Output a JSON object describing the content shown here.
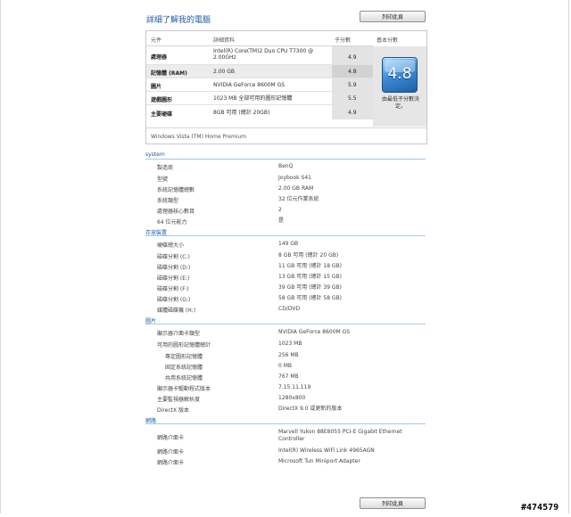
{
  "title": "詳細了解我的電腦",
  "print_label": "列印此頁",
  "score_table": {
    "headers": {
      "component": "元件",
      "details": "詳細資料",
      "subscore": "子分數",
      "base": "基本分數"
    },
    "rows": [
      {
        "component": "處理器",
        "detail_line1": "Intel(R) Core(TM)2 Duo CPU T7300 @",
        "detail_line2": "2.00GHz",
        "subscore": "4.9"
      },
      {
        "component": "記憶體 (RAM)",
        "detail_line1": "2.00 GB",
        "detail_line2": "",
        "subscore": "4.8"
      },
      {
        "component": "圖片",
        "detail_line1": "NVIDIA GeForce 8600M GS",
        "detail_line2": "",
        "subscore": "5.9"
      },
      {
        "component": "遊戲圖形",
        "detail_line1": "1023 MB 全部可用的圖形記憶體",
        "detail_line2": "",
        "subscore": "5.5"
      },
      {
        "component": "主要硬碟",
        "detail_line1": "8GB 可用 (總計 20GB)",
        "detail_line2": "",
        "subscore": "4.9"
      }
    ],
    "base_score": "4.8",
    "base_caption": "由最低子分數決定。",
    "edition": "Windows Vista (TM) Home Premium"
  },
  "sections": {
    "system": {
      "heading": "system",
      "rows": [
        {
          "label": "製造商",
          "value": "BenQ"
        },
        {
          "label": "型號",
          "value": "Joybook S41"
        },
        {
          "label": "系統記憶體總數",
          "value": "2.00 GB RAM"
        },
        {
          "label": "系統類型",
          "value": "32 位元作業系統"
        },
        {
          "label": "處理器核心數目",
          "value": "2"
        },
        {
          "label": "64 位元能力",
          "value": "是"
        }
      ]
    },
    "storage": {
      "heading": "存放裝置",
      "rows": [
        {
          "label": "硬碟總大小",
          "value": "149 GB"
        },
        {
          "label": "磁碟分割 (C:)",
          "value": "8 GB 可用 (總計 20 GB)"
        },
        {
          "label": "磁碟分割 (D:)",
          "value": "11 GB 可用 (總計 18 GB)"
        },
        {
          "label": "磁碟分割 (E:)",
          "value": "13 GB 可用 (總計 15 GB)"
        },
        {
          "label": "磁碟分割 (F:)",
          "value": "39 GB 可用 (總計 39 GB)"
        },
        {
          "label": "磁碟分割 (G:)",
          "value": "58 GB 可用 (總計 58 GB)"
        },
        {
          "label": "媒體磁碟機 (H:)",
          "value": "CD/DVD"
        }
      ]
    },
    "graphics": {
      "heading": "圖片",
      "rows": [
        {
          "label": "顯示器介面卡類型",
          "value": "NVIDIA GeForce 8600M GS",
          "indent": false
        },
        {
          "label": "可用的圖形記憶體總計",
          "value": "1023 MB",
          "indent": false
        },
        {
          "label": "專定圖形記憶體",
          "value": "256 MB",
          "indent": true
        },
        {
          "label": "固定系統記憶體",
          "value": "0 MB",
          "indent": true
        },
        {
          "label": "共用系統記憶體",
          "value": "767 MB",
          "indent": true
        },
        {
          "label": "顯示器卡驅動程式版本",
          "value": "7.15.11.119",
          "indent": false
        },
        {
          "label": "主要監視器解析度",
          "value": "1280x800",
          "indent": false
        },
        {
          "label": "DirectX 版本",
          "value": "DirectX 9.0 或更新的版本",
          "indent": false
        }
      ]
    },
    "network": {
      "heading": "網路",
      "rows": [
        {
          "label": "網路介面卡",
          "value": "Marvell Yukon 88E8055 PCI-E Gigabit Ethernet Controller"
        },
        {
          "label": "網路介面卡",
          "value": "Intel(R) Wireless WiFi Link 4965AGN"
        },
        {
          "label": "網路介面卡",
          "value": "Microsoft Tun Miniport Adapter"
        }
      ]
    }
  },
  "watermark": "#474579"
}
